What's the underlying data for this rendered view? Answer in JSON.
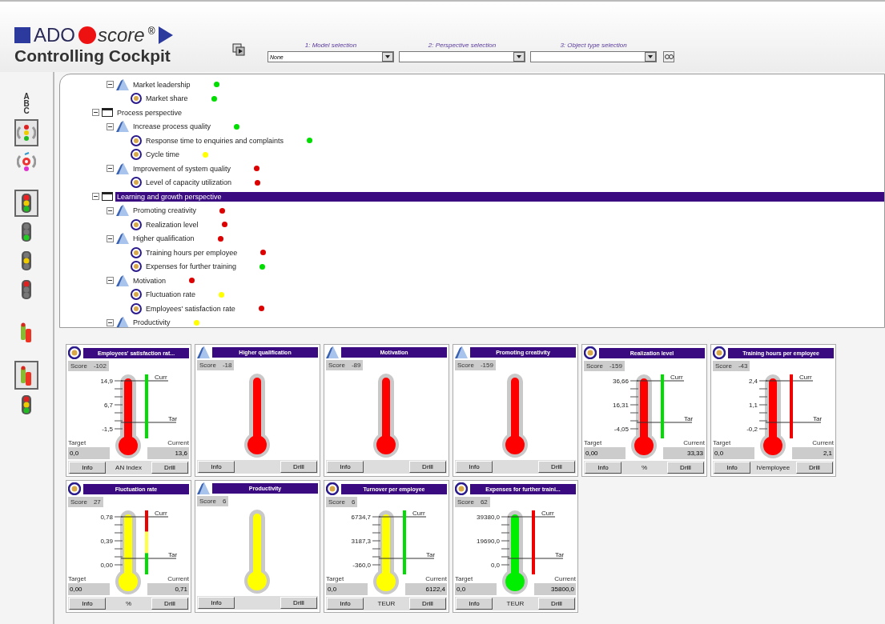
{
  "header": {
    "logo": {
      "brand": "ADO",
      "product": "score",
      "mark": "®",
      "subtitle": "Controlling Cockpit"
    },
    "selectors": [
      {
        "label": "1: Model selection",
        "value": "None"
      },
      {
        "label": "2: Perspective selection"
      },
      {
        "label": "3: Object type selection"
      }
    ]
  },
  "toolbar": [
    [
      {
        "kind": "abc",
        "label": "ABC",
        "selected": false
      },
      {
        "kind": "traffic-cycle",
        "selected": true
      },
      {
        "kind": "color-cycle",
        "selected": false
      }
    ],
    [
      {
        "kind": "traffic-all",
        "selected": true
      },
      {
        "kind": "traffic-green",
        "selected": false
      },
      {
        "kind": "traffic-yellow",
        "selected": false
      },
      {
        "kind": "traffic-red",
        "selected": false
      }
    ],
    [
      {
        "kind": "bars",
        "selected": false
      }
    ],
    [
      {
        "kind": "bars",
        "selected": true
      },
      {
        "kind": "traffic-small",
        "selected": false
      }
    ]
  ],
  "tree": [
    {
      "kind": "goal",
      "label": "Market leadership",
      "color": "#00dd00",
      "selected": false,
      "children": [
        {
          "kind": "kpi",
          "label": "Market share",
          "color": "#00dd00",
          "selected": false
        }
      ]
    },
    {
      "kind": "perspective",
      "label": "Process perspective",
      "selected": false,
      "children": [
        {
          "kind": "goal",
          "label": "Increase process quality",
          "color": "#00dd00",
          "selected": false,
          "children": [
            {
              "kind": "kpi",
              "label": "Response time to enquiries and complaints",
              "color": "#00dd00",
              "selected": false
            },
            {
              "kind": "kpi",
              "label": "Cycle time",
              "color": "#ffff00",
              "selected": false
            }
          ]
        },
        {
          "kind": "goal",
          "label": "Improvement of system quality",
          "color": "#dd0000",
          "selected": false,
          "children": [
            {
              "kind": "kpi",
              "label": "Level of capacity utilization",
              "color": "#dd0000",
              "selected": false
            }
          ]
        }
      ]
    },
    {
      "kind": "perspective",
      "label": "Learning and growth perspective",
      "selected": true,
      "children": [
        {
          "kind": "goal",
          "label": "Promoting creativity",
          "color": "#dd0000",
          "selected": false,
          "children": [
            {
              "kind": "kpi",
              "label": "Realization level",
              "color": "#dd0000",
              "selected": false
            }
          ]
        },
        {
          "kind": "goal",
          "label": "Higher qualification",
          "color": "#dd0000",
          "selected": false,
          "children": [
            {
              "kind": "kpi",
              "label": "Training hours per employee",
              "color": "#dd0000",
              "selected": false
            },
            {
              "kind": "kpi",
              "label": "Expenses for further training",
              "color": "#00dd00",
              "selected": false
            }
          ]
        },
        {
          "kind": "goal",
          "label": "Motivation",
          "color": "#dd0000",
          "selected": false,
          "children": [
            {
              "kind": "kpi",
              "label": "Fluctuation rate",
              "color": "#ffff00",
              "selected": false
            },
            {
              "kind": "kpi",
              "label": "Employees' satisfaction rate",
              "color": "#dd0000",
              "selected": false
            }
          ]
        },
        {
          "kind": "goal",
          "label": "Productivity",
          "color": "#ffff00",
          "selected": false
        }
      ]
    }
  ],
  "cards": [
    {
      "kind": "kpi",
      "title": "Employees' satisfaction rat...",
      "score_label": "Score",
      "score": "-102",
      "color": "#ff0000",
      "scale": {
        "ticks": [
          "14,9",
          "6,7",
          "-1,5"
        ],
        "curr_label": "Curr",
        "tar_label": "Tar",
        "indicator": [
          {
            "color": "#00dd00"
          }
        ],
        "target_label": "Target",
        "target": "0,0",
        "current_label": "Current",
        "current": "13,6"
      },
      "info": "Info",
      "unit": "AN Index",
      "drill": "Drill"
    },
    {
      "kind": "goal",
      "title": "Higher qualification",
      "score_label": "Score",
      "score": "-18",
      "color": "#ff0000",
      "info": "Info",
      "drill": "Drill"
    },
    {
      "kind": "goal",
      "title": "Motivation",
      "score_label": "Score",
      "score": "-89",
      "color": "#ff0000",
      "info": "Info",
      "drill": "Drill"
    },
    {
      "kind": "goal",
      "title": "Promoting creativity",
      "score_label": "Score",
      "score": "-159",
      "color": "#ff0000",
      "info": "Info",
      "drill": "Drill"
    },
    {
      "kind": "kpi",
      "title": "Realization level",
      "score_label": "Score",
      "score": "-159",
      "color": "#ff0000",
      "scale": {
        "ticks": [
          "36,66",
          "16,31",
          "-4,05"
        ],
        "curr_label": "Curr",
        "tar_label": "Tar",
        "indicator": [
          {
            "color": "#00dd00"
          }
        ],
        "target_label": "Target",
        "target": "0,00",
        "current_label": "Current",
        "current": "33,33"
      },
      "info": "Info",
      "unit": "%",
      "drill": "Drill"
    },
    {
      "kind": "kpi",
      "title": "Training hours per employee",
      "score_label": "Score",
      "score": "-43",
      "color": "#ff0000",
      "scale": {
        "ticks": [
          "2,4",
          "1,1",
          "-0,2"
        ],
        "curr_label": "Curr",
        "tar_label": "Tar",
        "indicator": [
          {
            "color": "#ee0000"
          }
        ],
        "target_label": "Target",
        "target": "0,0",
        "current_label": "Current",
        "current": "2,1"
      },
      "info": "Info",
      "unit": "h/employee",
      "drill": "Drill"
    },
    {
      "kind": "kpi",
      "title": "Fluctuation rate",
      "score_label": "Score",
      "score": "27",
      "color": "#ffff00",
      "scale": {
        "ticks": [
          "0,78",
          "0,39",
          "0,00"
        ],
        "curr_label": "Curr",
        "tar_label": "Tar",
        "indicator": [
          {
            "color": "#ee0000"
          },
          {
            "color": "#ffff44"
          },
          {
            "color": "#00dd00"
          }
        ],
        "target_label": "Target",
        "target": "0,00",
        "current_label": "Current",
        "current": "0,71"
      },
      "info": "Info",
      "unit": "%",
      "drill": "Drill"
    },
    {
      "kind": "goal",
      "title": "Productivity",
      "score_label": "Score",
      "score": "6",
      "color": "#ffff00",
      "info": "Info",
      "drill": "Drill"
    },
    {
      "kind": "kpi",
      "title": "Turnover per employee",
      "score_label": "Score",
      "score": "6",
      "color": "#ffff00",
      "scale": {
        "ticks": [
          "6734,7",
          "3187,3",
          "-360,0"
        ],
        "curr_label": "Curr",
        "tar_label": "Tar",
        "indicator": [
          {
            "color": "#00dd00"
          }
        ],
        "target_label": "Target",
        "target": "0,0",
        "current_label": "Current",
        "current": "6122,4"
      },
      "info": "Info",
      "unit": "TEUR",
      "drill": "Drill"
    },
    {
      "kind": "kpi",
      "title": "Expenses for further traini...",
      "score_label": "Score",
      "score": "62",
      "color": "#00ee00",
      "scale": {
        "ticks": [
          "39380,0",
          "19690,0",
          "0,0"
        ],
        "curr_label": "Curr",
        "tar_label": "Tar",
        "indicator": [
          {
            "color": "#ee0000"
          }
        ],
        "target_label": "Target",
        "target": "0,0",
        "current_label": "Current",
        "current": "35800,0"
      },
      "info": "Info",
      "unit": "TEUR",
      "drill": "Drill"
    }
  ]
}
